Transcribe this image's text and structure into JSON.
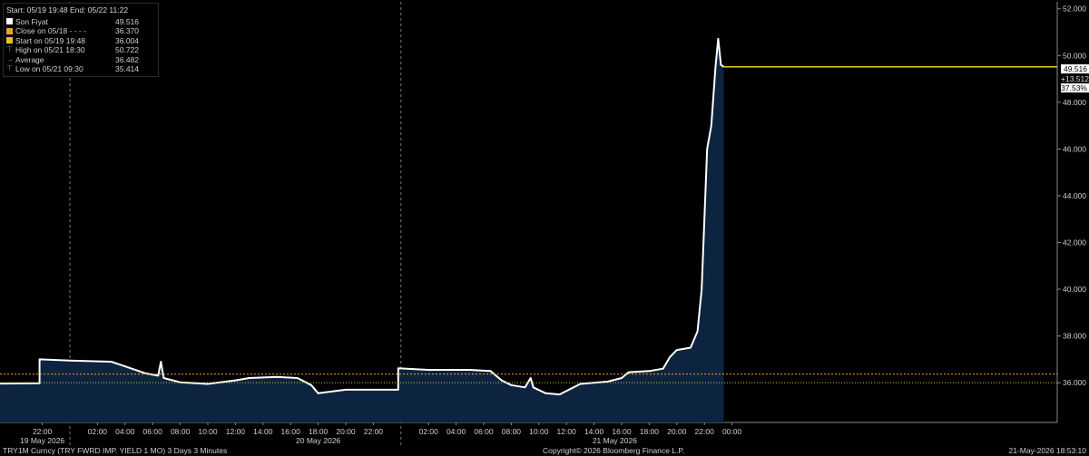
{
  "legend": {
    "header": "Start: 05/19 19:48 End: 05/22 11:22",
    "rows": [
      {
        "label": "Son Fiyat",
        "value": "49.516",
        "swatch": "#ffffff",
        "icon": "square-swatch"
      },
      {
        "label": "Close on 05/18 - - - -",
        "value": "36.370",
        "swatch": "#f0a030",
        "icon": "square-swatch"
      },
      {
        "label": "Start on 05/19 19:48",
        "value": "36.004",
        "swatch": "#e8c020",
        "icon": "square-swatch"
      },
      {
        "label": "High on 05/21 18:30",
        "value": "50.722",
        "swatch": "",
        "icon": "high-marker-icon"
      },
      {
        "label": "Average",
        "value": "36.482",
        "swatch": "",
        "icon": "average-marker-icon"
      },
      {
        "label": "Low on 05/21 09:30",
        "value": "35.414",
        "swatch": "",
        "icon": "low-marker-icon"
      }
    ]
  },
  "callouts": {
    "last": "49.516",
    "change": "+13.512",
    "pct": "37.53%"
  },
  "footer": {
    "left": "TRY1M Curncy (TRY FWRD IMP. YIELD 1 MO) 3 Days 3 Minutes",
    "center": "Copyright© 2026 Bloomberg Finance L.P.",
    "right": "21-May-2026 18:53:10"
  },
  "colors": {
    "line": "#ffffff",
    "fill": "#0c2440",
    "close_line": "#f0a030",
    "start_line": "#e8c020",
    "last_line": "#e8d020",
    "grid": "#3a3a3a"
  },
  "chart_data": {
    "type": "area",
    "series": [
      {
        "name": "Son Fiyat",
        "values": [
          [
            -8,
            35.95
          ],
          [
            -2.2,
            35.98
          ],
          [
            -2.2,
            37.0
          ],
          [
            0,
            36.95
          ],
          [
            3.0,
            36.9
          ],
          [
            4.5,
            36.6
          ],
          [
            5.5,
            36.4
          ],
          [
            6.4,
            36.3
          ],
          [
            6.6,
            36.9
          ],
          [
            6.8,
            36.2
          ],
          [
            8,
            36.02
          ],
          [
            10,
            35.95
          ],
          [
            12,
            36.1
          ],
          [
            13,
            36.2
          ],
          [
            15,
            36.25
          ],
          [
            16.5,
            36.2
          ],
          [
            17.5,
            35.9
          ],
          [
            18,
            35.55
          ],
          [
            20,
            35.7
          ],
          [
            22,
            35.7
          ],
          [
            23.8,
            35.7
          ],
          [
            23.8,
            36.62
          ],
          [
            26,
            36.55
          ],
          [
            29,
            36.55
          ],
          [
            30.5,
            36.5
          ],
          [
            31.3,
            36.1
          ],
          [
            32,
            35.9
          ],
          [
            33,
            35.8
          ],
          [
            33.4,
            36.2
          ],
          [
            33.6,
            35.8
          ],
          [
            34.5,
            35.55
          ],
          [
            35.5,
            35.5
          ],
          [
            37,
            35.95
          ],
          [
            39,
            36.05
          ],
          [
            40,
            36.2
          ],
          [
            40.5,
            36.45
          ],
          [
            42,
            36.5
          ],
          [
            43,
            36.6
          ],
          [
            43.5,
            37.1
          ],
          [
            44,
            37.4
          ],
          [
            45,
            37.5
          ],
          [
            45.5,
            38.2
          ],
          [
            45.8,
            40.0
          ],
          [
            46.2,
            46.0
          ],
          [
            46.5,
            47.0
          ],
          [
            46.8,
            49.5
          ],
          [
            47.0,
            50.722
          ],
          [
            47.2,
            49.6
          ],
          [
            47.4,
            49.516
          ]
        ]
      }
    ],
    "reference_lines": {
      "close_05_18": 36.37,
      "start_05_19": 36.004,
      "last": 49.516
    },
    "x_axis": {
      "time_ticks": [
        "22:00",
        "02:00",
        "04:00",
        "06:00",
        "08:00",
        "10:00",
        "12:00",
        "14:00",
        "16:00",
        "18:00",
        "20:00",
        "22:00",
        "02:00",
        "04:00",
        "06:00",
        "08:00",
        "10:00",
        "12:00",
        "14:00",
        "16:00",
        "18:00",
        "20:00",
        "22:00",
        "00:00"
      ],
      "day_labels": [
        "19 May 2026",
        "20 May 2026",
        "21 May 2026"
      ]
    },
    "y_axis": {
      "ticks": [
        "36.000",
        "38.000",
        "40.000",
        "42.000",
        "44.000",
        "46.000",
        "48.000",
        "50.000",
        "52.000"
      ],
      "ylim": [
        34.3,
        52.3
      ],
      "side": "right"
    },
    "grid": false,
    "legend_position": "top-left"
  }
}
